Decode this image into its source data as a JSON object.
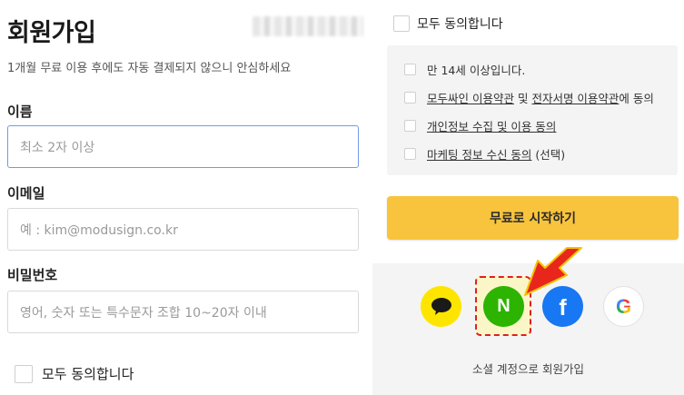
{
  "left": {
    "title": "회원가입",
    "subtitle": "1개월 무료 이용 후에도 자동 결제되지 않으니 안심하세요",
    "fields": [
      {
        "label": "이름",
        "placeholder": "최소 2자 이상"
      },
      {
        "label": "이메일",
        "placeholder": "예 : kim@modusign.co.kr"
      },
      {
        "label": "비밀번호",
        "placeholder": "영어, 숫자 또는 특수문자 조합 10~20자 이내"
      }
    ],
    "agree_all": "모두 동의합니다"
  },
  "right": {
    "agree_all": "모두 동의합니다",
    "terms": {
      "age": "만 14세 이상입니다.",
      "modu_terms": "모두싸인 이용약관",
      "and": " 및 ",
      "esign_terms": "전자서명 이용약관",
      "agree_suffix": "에 동의",
      "privacy": "개인정보 수집 및 이용 동의",
      "marketing": "마케팅 정보 수신 동의",
      "marketing_suffix": " (선택)"
    },
    "start_button": "무료로 시작하기",
    "social": {
      "naver_letter": "N",
      "facebook_letter": "f",
      "google_letter": "G",
      "caption": "소셜 계정으로 회원가입"
    }
  },
  "colors": {
    "start_button": "#f8c43d",
    "kakao": "#fee500",
    "naver": "#2db400",
    "facebook": "#1877f2",
    "highlight_border": "#e01f1f",
    "arrow": "#e8261c"
  },
  "icons": {
    "kakao": "speech-bubble-icon",
    "naver": "naver-logo-icon",
    "facebook": "facebook-logo-icon",
    "google": "google-logo-icon",
    "annotation": "red-arrow-icon"
  }
}
